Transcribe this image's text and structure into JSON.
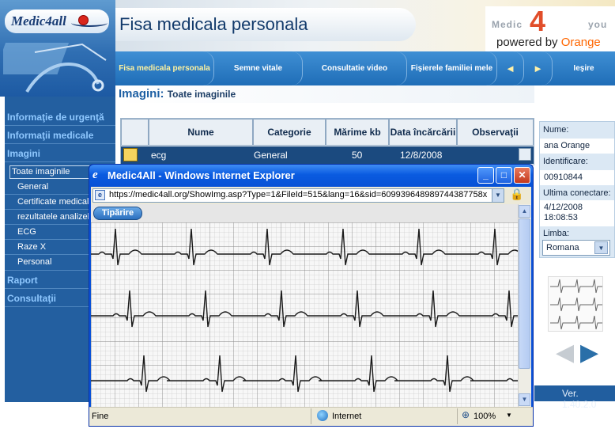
{
  "header": {
    "logo_text": "Medic4all",
    "page_title": "Fisa medicala personala",
    "brand": {
      "medic": "Medic",
      "four": "4",
      "you": "you",
      "powered_by": "powered by",
      "orange": "Orange"
    }
  },
  "top_nav": {
    "tabs": [
      {
        "label": "Fisa medicala personala",
        "active": true
      },
      {
        "label": "Semne vitale"
      },
      {
        "label": "Consultatie video"
      },
      {
        "label": "Fişierele familiei mele"
      }
    ],
    "prev_arrow": "◄",
    "next_arrow": "►",
    "exit_label": "Ieşire"
  },
  "section": {
    "title": "Imagini:",
    "subtitle": "Toate imaginile"
  },
  "sidebar": {
    "items": [
      {
        "label": "Informaţie de urgenţă"
      },
      {
        "label": "Informaţii medicale"
      },
      {
        "label": "Imagini"
      },
      {
        "label": "Toate imaginile",
        "selected": true
      },
      {
        "label": "General"
      },
      {
        "label": "Certificate medical"
      },
      {
        "label": "rezultatele analizel"
      },
      {
        "label": "ECG"
      },
      {
        "label": "Raze X"
      },
      {
        "label": "Personal"
      },
      {
        "label": "Raport"
      },
      {
        "label": "Consultaţii"
      }
    ]
  },
  "table": {
    "columns": [
      "Nume",
      "Categorie",
      "Mărime kb",
      "Data încărcării",
      "Observaţii"
    ],
    "rows": [
      {
        "name": "ecg",
        "category": "General",
        "size": "50",
        "date": "12/8/2008",
        "notes": ""
      }
    ]
  },
  "user_panel": {
    "name_label": "Nume:",
    "name_value": "ana Orange",
    "id_label": "Identificare:",
    "id_value": "00910844",
    "last_login_label": "Ultima conectare:",
    "last_login_date": "4/12/2008",
    "last_login_time": "18:08:53",
    "language_label": "Limba:",
    "language_value": "Romana"
  },
  "version": "Ver. 1.40.2.0",
  "popup": {
    "window_title": "Medic4All - Windows Internet Explorer",
    "url": "https://medic4all.org/ShowImg.asp?Type=1&FileId=515&lang=16&sid=609939648989744387758x",
    "print_label": "Tipărire",
    "status_text": "Fine",
    "zone": "Internet",
    "zoom": "100%"
  },
  "icons": {
    "ie": "ie-icon",
    "lock": "lock-icon",
    "globe": "internet-zone-icon",
    "zoom": "zoom-icon"
  },
  "colors": {
    "nav_blue": "#1f6db7",
    "sidebar_blue": "#235fa0",
    "selected_row": "#1b4a7f",
    "xp_title": "#0a5be0",
    "orange": "#ff6600"
  }
}
